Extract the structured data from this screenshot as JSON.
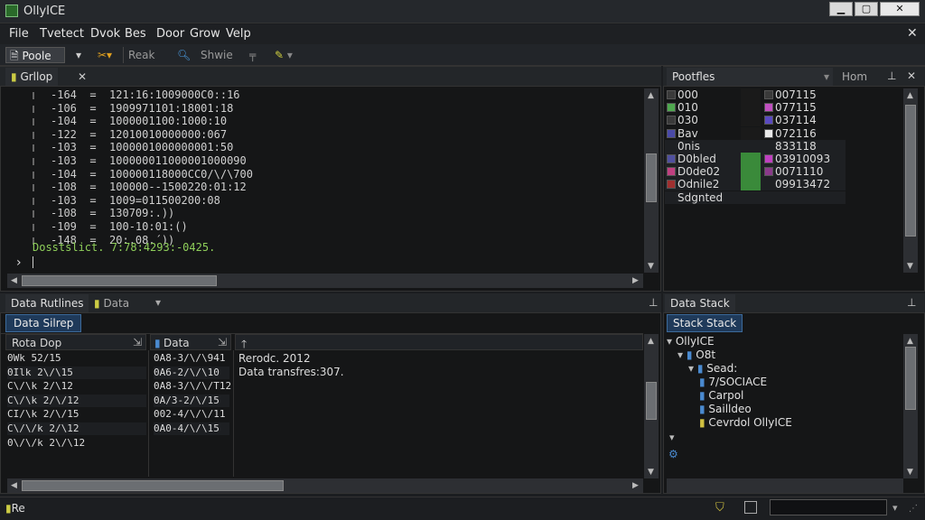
{
  "window": {
    "title": "OllyICE",
    "min": "▁",
    "max": "▢",
    "close": "✕"
  },
  "menu": [
    "File",
    "Tvetect",
    "Dvok",
    "Bes",
    "Door",
    "Grow",
    "Velp"
  ],
  "menu_close": "✕",
  "toolbar": {
    "paste": "Poole",
    "reak": "Reak",
    "shwie": "Shwie"
  },
  "code_panel": {
    "tab": "Grllop",
    "tab_close": "✕",
    "lines": [
      {
        "num": "-164",
        "val": "121:16:1009000C0::16"
      },
      {
        "num": "-106",
        "val": "1909971101:18001:18"
      },
      {
        "num": "-104",
        "val": "1000001100:1000:10"
      },
      {
        "num": "-122",
        "val": "12010010000000:067"
      },
      {
        "num": "-103",
        "val": "1000001000000001:50"
      },
      {
        "num": "-103",
        "val": "100000011000001000090"
      },
      {
        "num": "-104",
        "val": "100000118000CC0/\\/\\700"
      },
      {
        "num": "-108",
        "val": "100000--1500220:01:12"
      },
      {
        "num": "-103",
        "val": "1009=011500200:08"
      },
      {
        "num": "-108",
        "val": "130709:.))"
      },
      {
        "num": "-109",
        "val": "100-10:01:()"
      },
      {
        "num": "-148",
        "val": "20:.08.´))"
      }
    ],
    "status_line": "Dosstslict. 7:78:4293:-0425.",
    "prompt": "›"
  },
  "registers_panel": {
    "tab": "Pootfles",
    "tab2": "Hom",
    "rows": [
      {
        "name": "000",
        "c1": "#3a3a3a",
        "c2": "#1a1a1a",
        "c3": "#3a3a3a",
        "val": "007115"
      },
      {
        "name": "010",
        "c1": "#4fa84f",
        "c2": "#1a1a1a",
        "c3": "#c050c0",
        "val": "077115"
      },
      {
        "name": "030",
        "c1": "#3a3a3a",
        "c2": "#1a1a1a",
        "c3": "#5a4ac0",
        "val": "037114"
      },
      {
        "name": "Bav",
        "c1": "#4a4aa8",
        "c2": "#1a1a1a",
        "c3": "#e8e8e8",
        "val": "072116"
      },
      {
        "name": "0nis",
        "c1": "",
        "c2": "",
        "c3": "",
        "val": "833118"
      },
      {
        "name": "D0bled",
        "c1": "#5050a0",
        "c2": "#3a8a3a",
        "c3": "#c040c0",
        "val": "03910093"
      },
      {
        "name": "D0de02",
        "c1": "#c04080",
        "c2": "#3a8a3a",
        "c3": "#8a3a8a",
        "val": "0071110"
      },
      {
        "name": "Odnile2",
        "c1": "#a03030",
        "c2": "#3a8a3a",
        "c3": "",
        "val": "09913472"
      },
      {
        "name": "Sdgnted",
        "c1": "",
        "c2": "",
        "c3": "",
        "val": ""
      }
    ]
  },
  "data_panel": {
    "tab1": "Data Rutlines",
    "tab2": "Data",
    "subtab": "Data Silrep",
    "col1_header": "Rota Dop",
    "col2_header": "Data",
    "col1": [
      "0Wk 52/15",
      "0Ιlk 2\\/\\15",
      "C\\/\\k 2/\\12",
      "C\\/\\k 2/\\/12",
      "CΙ/\\k 2/\\/15",
      "C\\/\\/k 2/\\12",
      "0\\/\\/k 2\\/\\12"
    ],
    "col2": [
      "0A8-3/\\/\\941",
      "0A6-2/\\/\\10",
      "0A8-3/\\/\\/Τ12",
      "0A/3-2/\\/15",
      "002-4/\\/\\/11",
      "0A0-4/\\/\\15",
      ""
    ],
    "detail": [
      "Rerodc. 2012",
      "Data transfres:307."
    ]
  },
  "stack_panel": {
    "tab": "Data Stack",
    "subtab": "Stack Stack",
    "tree": [
      {
        "indent": 0,
        "arrow": "▾",
        "label": "OllyICE"
      },
      {
        "indent": 1,
        "arrow": "▾",
        "label": "O8t"
      },
      {
        "indent": 2,
        "arrow": "▾",
        "label": "Sead:"
      },
      {
        "indent": 3,
        "arrow": "",
        "label": "7/SOCIACE"
      },
      {
        "indent": 3,
        "arrow": "",
        "label": "Carpol"
      },
      {
        "indent": 3,
        "arrow": "",
        "label": "Sailldeo"
      },
      {
        "indent": 3,
        "arrow": "",
        "label": "Cevrdol OllyICE"
      }
    ]
  },
  "status": {
    "left": "Re"
  }
}
